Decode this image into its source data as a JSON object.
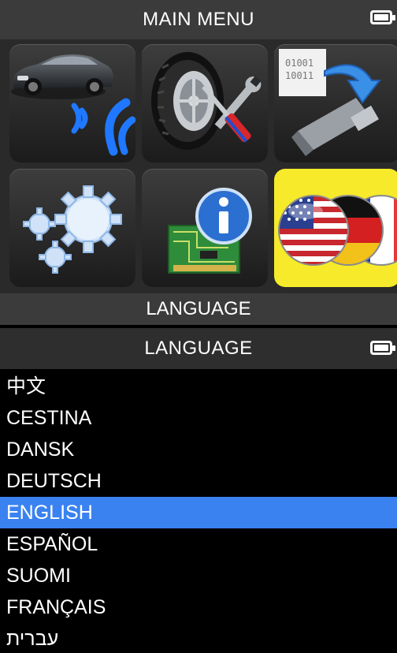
{
  "main_menu": {
    "title": "MAIN MENU",
    "battery_icon": "battery-full-icon",
    "tiles": [
      {
        "name": "vehicle-sensor-scan",
        "icon": "car-wireless-icon",
        "selected": false
      },
      {
        "name": "tire-service",
        "icon": "tire-tools-icon",
        "selected": false
      },
      {
        "name": "sensor-programming",
        "icon": "binary-download-icon",
        "selected": false
      },
      {
        "name": "settings",
        "icon": "gears-icon",
        "selected": false
      },
      {
        "name": "info",
        "icon": "circuit-info-icon",
        "selected": false
      },
      {
        "name": "language",
        "icon": "flags-icon",
        "selected": true
      }
    ],
    "selected_label": "LANGUAGE"
  },
  "language_screen": {
    "title": "LANGUAGE",
    "battery_icon": "battery-full-icon",
    "items": [
      {
        "label": "中文",
        "selected": false
      },
      {
        "label": "CESTINA",
        "selected": false
      },
      {
        "label": "DANSK",
        "selected": false
      },
      {
        "label": "DEUTSCH",
        "selected": false
      },
      {
        "label": "ENGLISH",
        "selected": true
      },
      {
        "label": "ESPAÑOL",
        "selected": false
      },
      {
        "label": "SUOMI",
        "selected": false
      },
      {
        "label": "FRANÇAIS",
        "selected": false
      },
      {
        "label": "עברית",
        "selected": false
      }
    ]
  },
  "colors": {
    "highlight": "#3a82f0",
    "selected_tile": "#f6ea2a",
    "bar": "#3b3b3b",
    "text": "#ffffff"
  }
}
